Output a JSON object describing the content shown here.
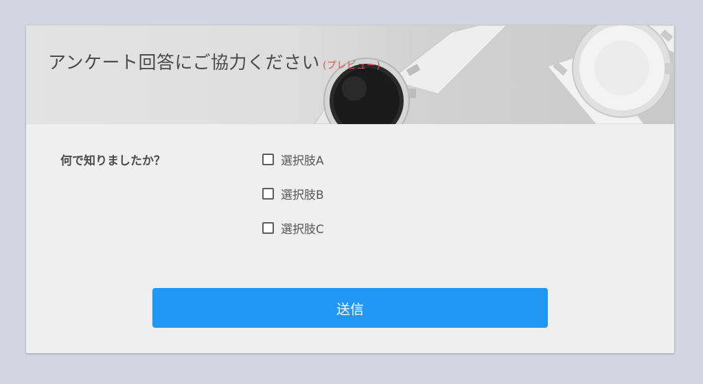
{
  "header": {
    "title": "アンケート回答にご協力ください",
    "preview_tag": "(プレビュー)",
    "image": "smartwatch-photo"
  },
  "question": {
    "label": "何で知りましたか？",
    "options": [
      {
        "label": "選択肢A",
        "checked": false
      },
      {
        "label": "選択肢B",
        "checked": false
      },
      {
        "label": "選択肢C",
        "checked": false
      }
    ]
  },
  "submit": {
    "label": "送信"
  },
  "colors": {
    "page_background": "#d3d6e2",
    "card_background": "#efefef",
    "primary_button": "#2196f3",
    "preview_tag": "#d9534f"
  }
}
